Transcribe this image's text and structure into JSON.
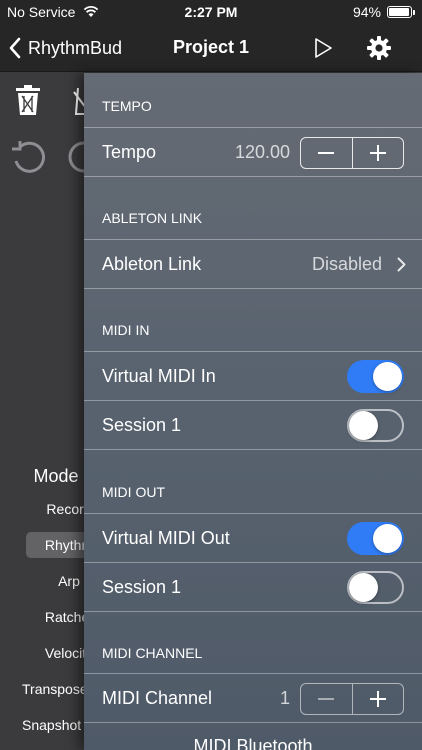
{
  "status_bar": {
    "carrier": "No Service",
    "time": "2:27 PM",
    "battery_percent": "94%",
    "battery_level": 0.94
  },
  "nav": {
    "back_label": "RhythmBud",
    "title": "Project 1"
  },
  "left_panel": {
    "mode_title": "Mode",
    "modes": [
      "Record",
      "Rhythm",
      "Arp",
      "Ratchet",
      "Velocity",
      "Transpose",
      "Snapshot"
    ],
    "active_mode": "Rhythm"
  },
  "settings": {
    "tempo_section": {
      "header": "TEMPO",
      "label": "Tempo",
      "value": "120.00"
    },
    "link_section": {
      "header": "ABLETON LINK",
      "label": "Ableton Link",
      "value": "Disabled"
    },
    "midi_in_section": {
      "header": "MIDI IN",
      "rows": [
        {
          "label": "Virtual MIDI In",
          "on": true
        },
        {
          "label": "Session 1",
          "on": false
        }
      ]
    },
    "midi_out_section": {
      "header": "MIDI OUT",
      "rows": [
        {
          "label": "Virtual MIDI Out",
          "on": true
        },
        {
          "label": "Session 1",
          "on": false
        }
      ]
    },
    "midi_channel_section": {
      "header": "MIDI CHANNEL",
      "label": "MIDI Channel",
      "value": "1"
    },
    "footer_label": "MIDI Bluetooth"
  },
  "colors": {
    "toggle_on": "#2f7cf6",
    "bar_background": "#262627"
  }
}
